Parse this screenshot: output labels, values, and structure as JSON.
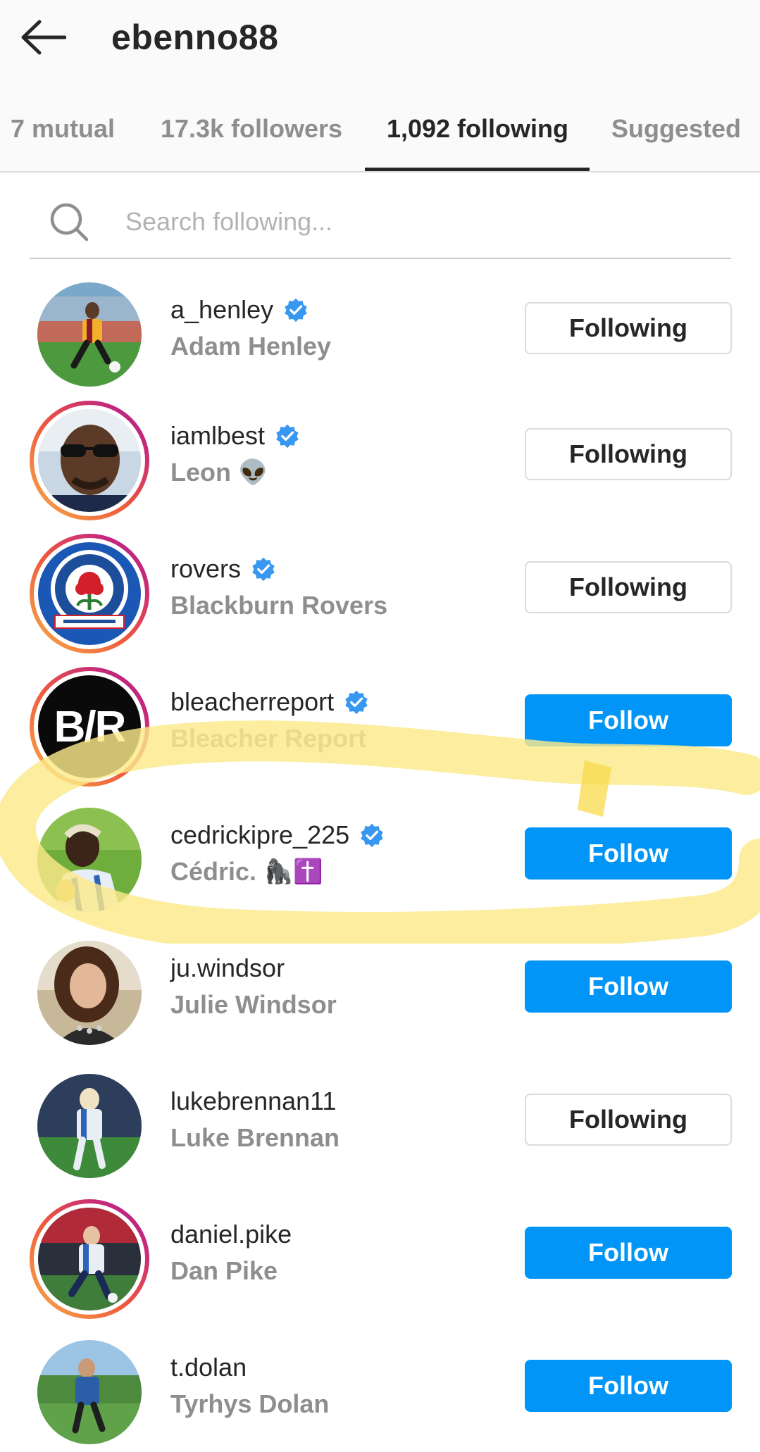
{
  "header": {
    "username": "ebenno88",
    "back_icon": "arrow-left-icon"
  },
  "tabs": [
    {
      "label": "7 mutual",
      "active": false
    },
    {
      "label": "17.3k followers",
      "active": false
    },
    {
      "label": "1,092 following",
      "active": true
    },
    {
      "label": "Suggested",
      "active": false
    }
  ],
  "search": {
    "placeholder": "Search following...",
    "value": ""
  },
  "users": [
    {
      "handle": "a_henley",
      "name": "Adam Henley",
      "emoji": "",
      "verified": true,
      "button": "Following",
      "story_ring": false
    },
    {
      "handle": "iamlbest",
      "name": "Leon",
      "emoji": "👽",
      "verified": true,
      "button": "Following",
      "story_ring": true
    },
    {
      "handle": "rovers",
      "name": "Blackburn Rovers",
      "emoji": "",
      "verified": true,
      "button": "Following",
      "story_ring": true
    },
    {
      "handle": "bleacherreport",
      "name": "Bleacher Report",
      "emoji": "",
      "verified": true,
      "button": "Follow",
      "story_ring": true,
      "avatar_text": "B/R"
    },
    {
      "handle": "cedrickipre_225",
      "name": "Cédric.",
      "emoji": "🦍✝️",
      "verified": true,
      "button": "Follow",
      "story_ring": false
    },
    {
      "handle": "ju.windsor",
      "name": "Julie Windsor",
      "emoji": "",
      "verified": false,
      "button": "Follow",
      "story_ring": false
    },
    {
      "handle": "lukebrennan11",
      "name": "Luke Brennan",
      "emoji": "",
      "verified": false,
      "button": "Following",
      "story_ring": false
    },
    {
      "handle": "daniel.pike",
      "name": "Dan Pike",
      "emoji": "",
      "verified": false,
      "button": "Follow",
      "story_ring": true
    },
    {
      "handle": "t.dolan",
      "name": "Tyrhys Dolan",
      "emoji": "",
      "verified": false,
      "button": "Follow",
      "story_ring": false
    }
  ],
  "colors": {
    "follow_blue": "#0095f6",
    "verified_blue": "#3897f0",
    "highlight_yellow": "#fbe98a"
  }
}
